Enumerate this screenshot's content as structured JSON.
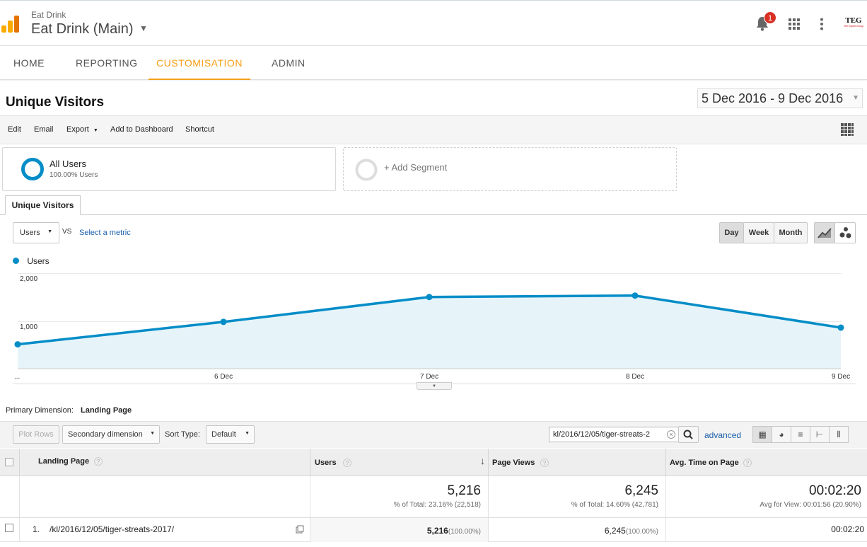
{
  "header": {
    "account": "Eat Drink",
    "property": "Eat Drink (Main)",
    "notification_count": "1",
    "logo_text": "TEG",
    "logo_subtext": "The Expert Group"
  },
  "nav": {
    "tabs": [
      "HOME",
      "REPORTING",
      "CUSTOMISATION",
      "ADMIN"
    ],
    "active": "CUSTOMISATION"
  },
  "report": {
    "title": "Unique Visitors",
    "date_range": "5 Dec 2016 - 9 Dec 2016",
    "toolbar": {
      "edit": "Edit",
      "email": "Email",
      "export": "Export",
      "add_to_dashboard": "Add to Dashboard",
      "shortcut": "Shortcut"
    }
  },
  "segments": {
    "all_users_label": "All Users",
    "all_users_pct": "100.00% Users",
    "add_segment": "+ Add Segment"
  },
  "explorer_tab": "Unique Visitors",
  "chart_controls": {
    "metric": "Users",
    "vs": "VS",
    "select_metric": "Select a metric",
    "periods": [
      "Day",
      "Week",
      "Month"
    ],
    "active_period": "Day"
  },
  "chart_data": {
    "type": "area",
    "x": [
      "...",
      "6 Dec",
      "7 Dec",
      "8 Dec",
      "9 Dec"
    ],
    "series": [
      {
        "name": "Users",
        "values": [
          510,
          980,
          1500,
          1530,
          860
        ]
      }
    ],
    "ylim": [
      0,
      2000
    ],
    "yticks": [
      "2,000",
      "1,000"
    ],
    "grid": true,
    "legend": "top-left",
    "color": "#058dc7"
  },
  "table_controls": {
    "primary_dimension_label": "Primary Dimension:",
    "primary_dimension_value": "Landing Page",
    "plot_rows": "Plot Rows",
    "secondary_dimension": "Secondary dimension",
    "sort_type_label": "Sort Type:",
    "sort_type_value": "Default",
    "search_value": "kl/2016/12/05/tiger-streats-2",
    "advanced": "advanced"
  },
  "table": {
    "columns": [
      "Landing Page",
      "Users",
      "Page Views",
      "Avg. Time on Page"
    ],
    "totals": {
      "users": "5,216",
      "users_sub": "% of Total: 23.16% (22,518)",
      "page_views": "6,245",
      "page_views_sub": "% of Total: 14.60% (42,781)",
      "avg_time": "00:02:20",
      "avg_time_sub": "Avg for View: 00:01:56 (20.90%)"
    },
    "rows": [
      {
        "index": "1.",
        "page": "/kl/2016/12/05/tiger-streats-2017/",
        "users": "5,216",
        "users_pct": "(100.00%)",
        "page_views": "6,245",
        "page_views_pct": "(100.00%)",
        "avg_time": "00:02:20"
      }
    ]
  }
}
